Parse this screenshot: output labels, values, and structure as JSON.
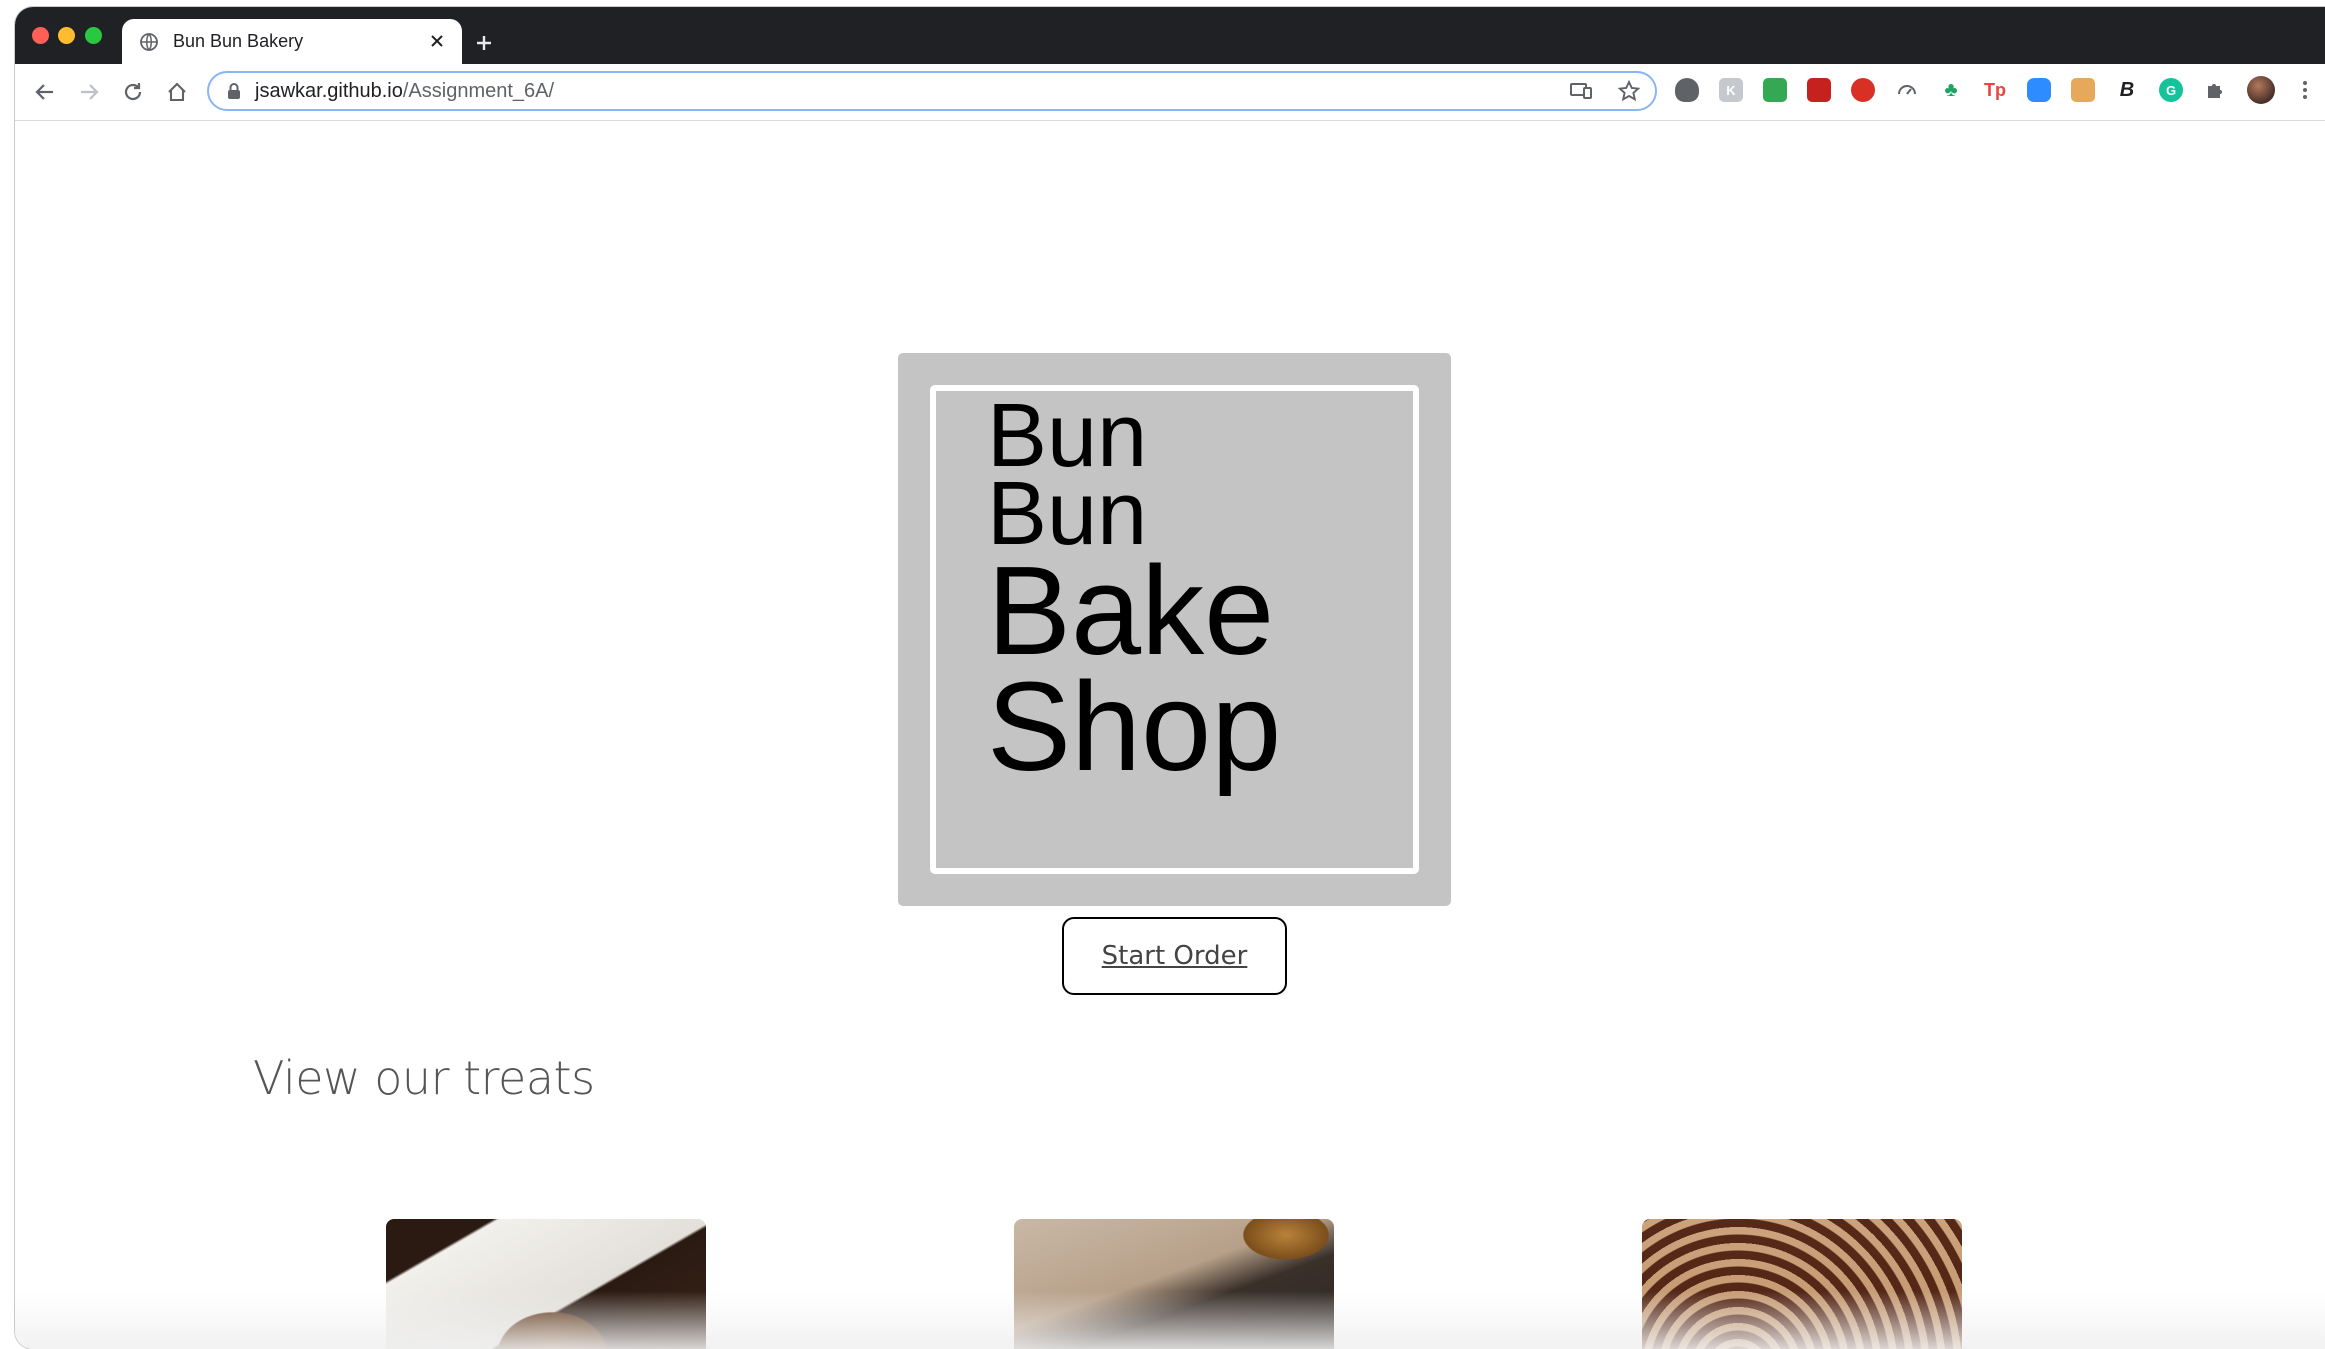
{
  "browser": {
    "tab_title": "Bun Bun Bakery",
    "url_host": "jsawkar.github.io",
    "url_path": "/Assignment_6A/",
    "extensions": [
      {
        "name": "lightbulb-extension-icon",
        "glyph": "",
        "color": "#5f6368"
      },
      {
        "name": "k-extension-icon",
        "glyph": "K",
        "color": "#9aa0a6"
      },
      {
        "name": "print-extension-icon",
        "glyph": "",
        "color": "#34a853"
      },
      {
        "name": "video-extension-icon",
        "glyph": "",
        "color": "#c5221f"
      },
      {
        "name": "ublock-extension-icon",
        "glyph": "",
        "color": "#d93025"
      },
      {
        "name": "speed-extension-icon",
        "glyph": "",
        "color": "#5f6368"
      },
      {
        "name": "tree-extension-icon",
        "glyph": "",
        "color": "#1ea362"
      },
      {
        "name": "tp-extension-icon",
        "glyph": "Tp",
        "color": "#e8453c"
      },
      {
        "name": "zoom-extension-icon",
        "glyph": "",
        "color": "#2d8cff"
      },
      {
        "name": "bag-extension-icon",
        "glyph": "",
        "color": "#e6a85a"
      },
      {
        "name": "bold-b-extension-icon",
        "glyph": "B",
        "color": "#202124"
      },
      {
        "name": "grammarly-extension-icon",
        "glyph": "G",
        "color": "#15c39a"
      }
    ]
  },
  "logo": {
    "line1": "Bun",
    "line2": "Bun",
    "line3": "Bake",
    "line4": "Shop"
  },
  "cta": {
    "start_order": "Start Order"
  },
  "treats": {
    "heading": "View our treats"
  },
  "colors": {
    "logo_box": "#c4c4c4",
    "omnibox_focus": "#8ab4f8"
  }
}
